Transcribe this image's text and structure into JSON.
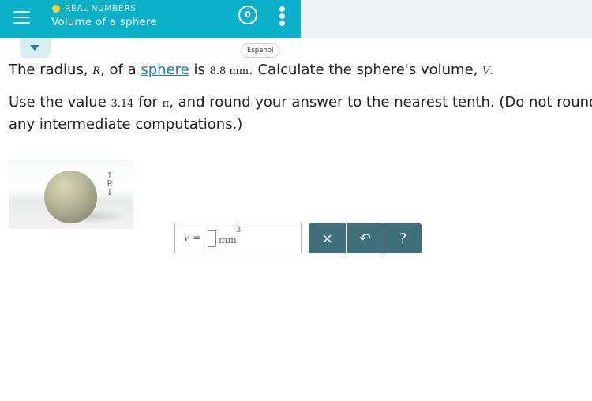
{
  "header": {
    "topic": "REAL NUMBERS",
    "title": "Volume of a sphere",
    "score": "0",
    "topic_dot_color": "#f5d033",
    "bar_color": "#0bb0c9"
  },
  "language_button": "Español",
  "question": {
    "line1": {
      "p1": "The radius, ",
      "var_r": "R",
      "p2": ", of a ",
      "link": "sphere",
      "p3": " is ",
      "value": "8.8 mm",
      "p4": ". Calculate the sphere's volume, ",
      "var_v": "V",
      "p5": "."
    },
    "line2": {
      "p1": "Use the value ",
      "pi_value": "3.14",
      "p2": " for ",
      "pi": "π",
      "p3": ", and round your answer to the nearest tenth. (Do not round any intermediate computations.)"
    }
  },
  "figure": {
    "label": "R",
    "arrow_up": "↑",
    "arrow_down": "↓"
  },
  "answer": {
    "variable": "V",
    "equals": "=",
    "unit": "mm",
    "exponent": "3",
    "value": ""
  },
  "buttons": {
    "clear": "×",
    "undo": "↶",
    "help": "?"
  }
}
